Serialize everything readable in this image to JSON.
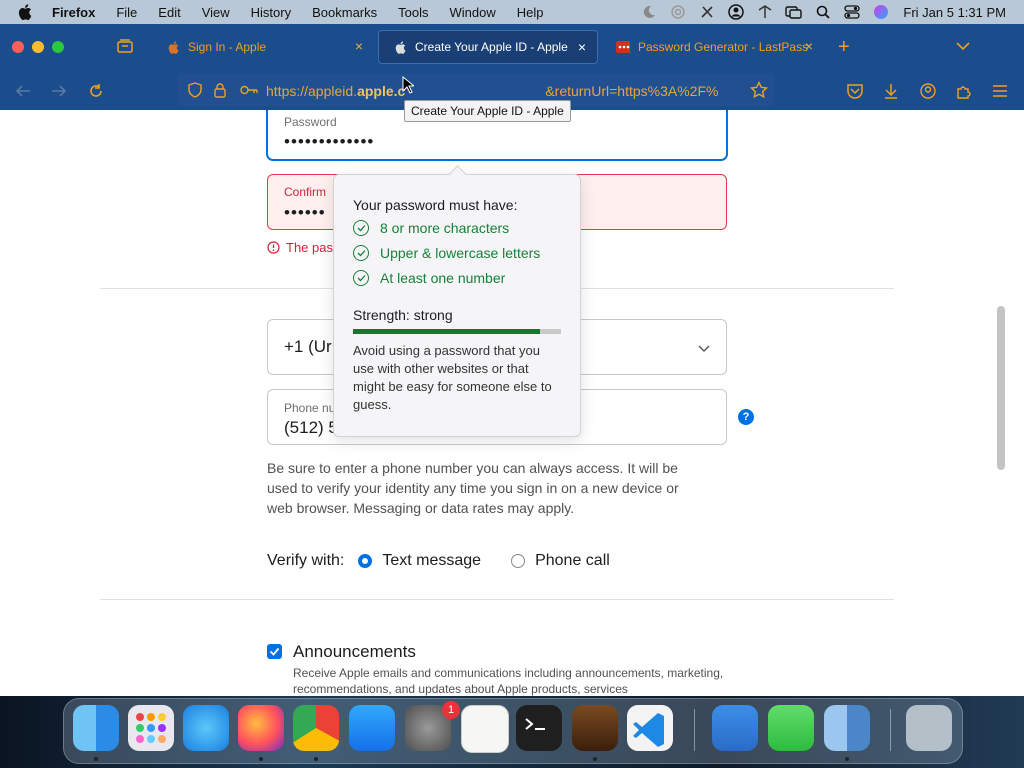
{
  "menubar": {
    "app_name": "Firefox",
    "items": [
      "File",
      "Edit",
      "View",
      "History",
      "Bookmarks",
      "Tools",
      "Window",
      "Help"
    ],
    "clock": "Fri Jan 5  1:31 PM"
  },
  "tabs": [
    {
      "title": "Sign In - Apple",
      "active": false
    },
    {
      "title": "Create Your Apple ID - Apple",
      "active": true
    },
    {
      "title": "Password Generator - LastPass",
      "active": false
    }
  ],
  "urlbar": {
    "url_prefix": "https://appleid.",
    "url_domain": "apple.c",
    "url_suffix": "&returnUrl=https%3A%2F%"
  },
  "tooltip": "Create Your Apple ID - Apple",
  "form": {
    "password_label": "Password",
    "password_value": "•••••••••••••",
    "confirm_label": "Confirm",
    "confirm_value": "••••••",
    "error_text": "The pas",
    "country_value": "+1 (Ur",
    "phone_label": "Phone nu",
    "phone_value": "(512) 5",
    "help_label": "?",
    "note": "Be sure to enter a phone number you can always access. It will be used to verify your identity any time you sign in on a new device or web browser. Messaging or data rates may apply.",
    "verify_label": "Verify with:",
    "verify_options": [
      "Text message",
      "Phone call"
    ],
    "verify_selected": "Text message",
    "announce_title": "Announcements",
    "announce_desc": "Receive Apple emails and communications including announcements, marketing, recommendations, and updates about Apple products, services",
    "announce_checked": true
  },
  "popover": {
    "title": "Your password must have:",
    "requirements": [
      "8 or more characters",
      "Upper & lowercase letters",
      "At least one number"
    ],
    "strength_label": "Strength: strong",
    "strength_fraction": 0.9,
    "note": "Avoid using a password that you use with other websites or that might be easy for someone else to guess."
  },
  "dock": {
    "apps": [
      "Finder",
      "Launchpad",
      "Safari",
      "Firefox",
      "Chrome",
      "App Store",
      "System Settings",
      "TextEdit",
      "Terminal",
      "GarageBand",
      "Visual Studio Code",
      "Weather",
      "Messages",
      "Preview",
      "Trash"
    ],
    "settings_badge": "1"
  },
  "colors": {
    "accent": "#0071e3",
    "success": "#17803a",
    "error": "#d0243a",
    "toolbar": "#1b4c8c",
    "tab_text": "#f0a020"
  }
}
